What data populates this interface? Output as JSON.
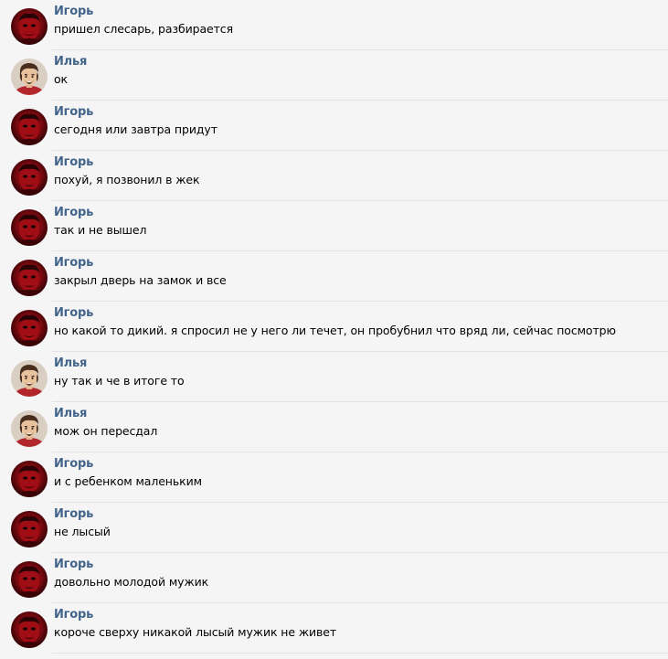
{
  "messages": [
    {
      "author": "Игорь",
      "avatar": "red-demon-avatar",
      "text": "пришел слесарь, разбирается"
    },
    {
      "author": "Илья",
      "avatar": "cartoon-man-avatar",
      "text": "ок"
    },
    {
      "author": "Игорь",
      "avatar": "red-demon-avatar",
      "text": "сегодня или завтра придут"
    },
    {
      "author": "Игорь",
      "avatar": "red-demon-avatar",
      "text": "похуй, я позвонил в жек"
    },
    {
      "author": "Игорь",
      "avatar": "red-demon-avatar",
      "text": "так и не вышел"
    },
    {
      "author": "Игорь",
      "avatar": "red-demon-avatar",
      "text": "закрыл дверь на замок и все"
    },
    {
      "author": "Игорь",
      "avatar": "red-demon-avatar",
      "text": "но какой то дикий. я спросил не у него ли течет, он пробубнил что вряд ли, сейчас посмотрю"
    },
    {
      "author": "Илья",
      "avatar": "cartoon-man-avatar",
      "text": "ну так и че в итоге то"
    },
    {
      "author": "Илья",
      "avatar": "cartoon-man-avatar",
      "text": "мож он пересдал"
    },
    {
      "author": "Игорь",
      "avatar": "red-demon-avatar",
      "text": "и с ребенком маленьким"
    },
    {
      "author": "Игорь",
      "avatar": "red-demon-avatar",
      "text": "не лысый"
    },
    {
      "author": "Игорь",
      "avatar": "red-demon-avatar",
      "text": "довольно молодой мужик"
    },
    {
      "author": "Игорь",
      "avatar": "red-demon-avatar",
      "text": "короче сверху никакой лысый мужик не живет"
    }
  ],
  "colors": {
    "background": "#f5f5f5",
    "author_name": "#42648b",
    "message_text": "#000000",
    "separator": "#e2e2e2"
  }
}
